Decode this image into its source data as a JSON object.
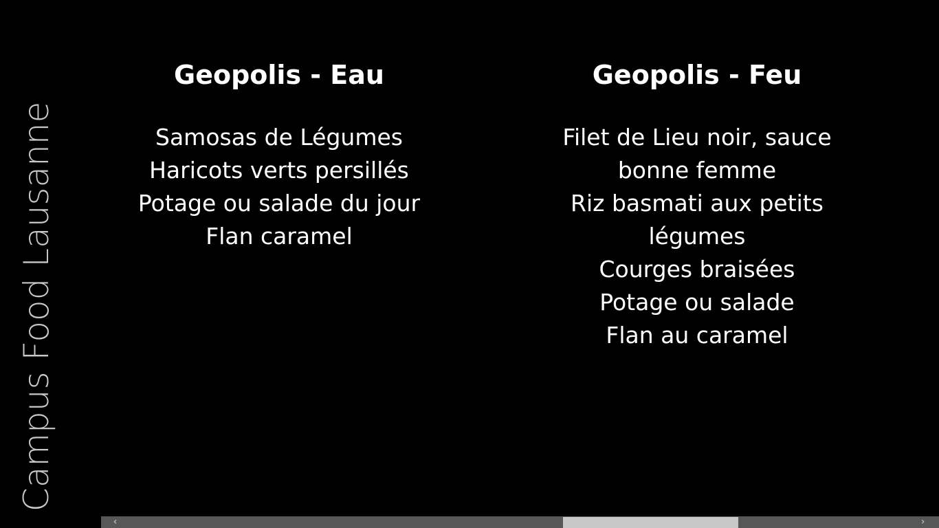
{
  "app": {
    "title": "Campus Food Lausanne"
  },
  "menus": [
    {
      "name": "Geopolis - Eau",
      "items": [
        "Samosas de Légumes",
        "Haricots verts persillés",
        "Potage ou salade du jour",
        "Flan caramel"
      ]
    },
    {
      "name": "Geopolis - Feu",
      "items": [
        "Filet de Lieu noir, sauce bonne femme",
        "Riz basmati aux petits légumes",
        "Courges braisées",
        "Potage ou salade",
        "Flan au caramel"
      ]
    }
  ],
  "scrollbar": {
    "left_arrow": "‹",
    "right_arrow": "›"
  }
}
